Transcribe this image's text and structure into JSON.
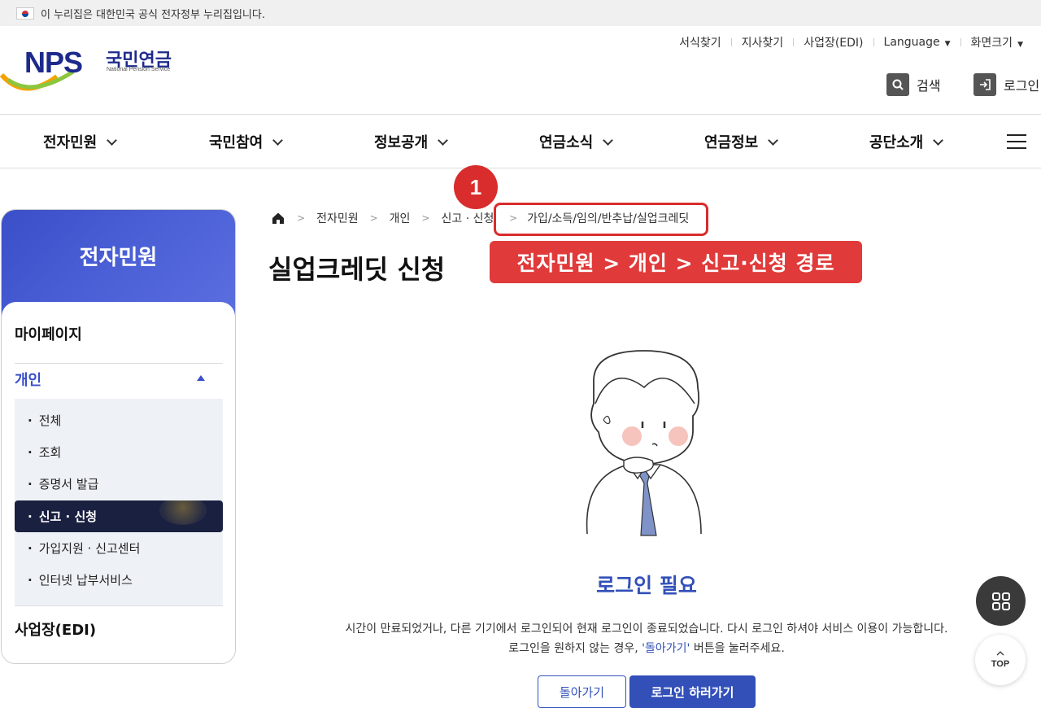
{
  "gov_banner": {
    "text": "이 누리집은 대한민국 공식 전자정부 누리집입니다."
  },
  "logo": {
    "mark": "NPS",
    "name_ko": "국민연금",
    "name_en": "National Pension Service"
  },
  "utility_links": [
    "서식찾기",
    "지사찾기",
    "사업장(EDI)",
    "Language",
    "화면크기"
  ],
  "header_buttons": {
    "search": "검색",
    "login": "로그인"
  },
  "gnb": [
    "전자민원",
    "국민참여",
    "정보공개",
    "연금소식",
    "연금정보",
    "공단소개"
  ],
  "sidebar": {
    "title": "전자민원",
    "sections": [
      "마이페이지",
      "개인",
      "사업장(EDI)"
    ],
    "sub_items": [
      "전체",
      "조회",
      "증명서 발급",
      "신고 · 신청",
      "가입지원 · 신고센터",
      "인터넷 납부서비스"
    ],
    "active_item": "신고 · 신청"
  },
  "breadcrumb": [
    "전자민원",
    "개인",
    "신고 · 신청",
    "가입/소득/임의/반추납/실업크레딧"
  ],
  "annotation": {
    "step_number": "1",
    "path_label": "전자민원 > 개인 > 신고·신청 경로"
  },
  "page_title": "실업크레딧 신청",
  "login_required": {
    "title": "로그인 필요",
    "message_line1": "시간이 만료되었거나, 다른 기기에서 로그인되어 현재 로그인이 종료되었습니다. 다시 로그인 하셔야 서비스 이용이 가능합니다.",
    "message_line2_prefix": "로그인을 원하지 않는 경우, ",
    "message_line2_link": "'돌아가기'",
    "message_line2_suffix": " 버튼을 눌러주세요.",
    "back_button": "돌아가기",
    "login_button": "로그인 하러가기"
  },
  "floating": {
    "top_label": "TOP"
  },
  "colors": {
    "brand_blue": "#3250b8",
    "highlight_red": "#e03a3a",
    "sidebar_active": "#1a2040"
  }
}
